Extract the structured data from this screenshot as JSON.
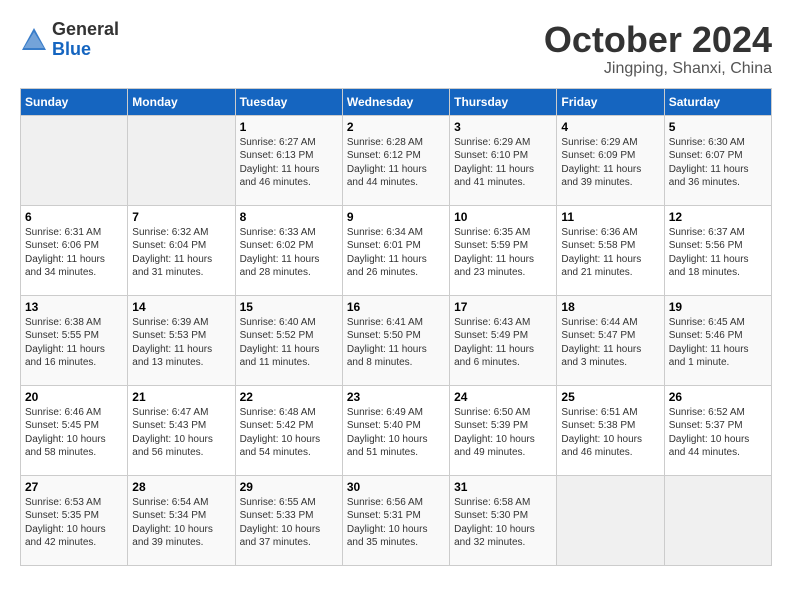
{
  "header": {
    "logo_general": "General",
    "logo_blue": "Blue",
    "month": "October 2024",
    "location": "Jingping, Shanxi, China"
  },
  "days_of_week": [
    "Sunday",
    "Monday",
    "Tuesday",
    "Wednesday",
    "Thursday",
    "Friday",
    "Saturday"
  ],
  "weeks": [
    [
      {
        "day": "",
        "content": ""
      },
      {
        "day": "",
        "content": ""
      },
      {
        "day": "1",
        "content": "Sunrise: 6:27 AM\nSunset: 6:13 PM\nDaylight: 11 hours and 46 minutes."
      },
      {
        "day": "2",
        "content": "Sunrise: 6:28 AM\nSunset: 6:12 PM\nDaylight: 11 hours and 44 minutes."
      },
      {
        "day": "3",
        "content": "Sunrise: 6:29 AM\nSunset: 6:10 PM\nDaylight: 11 hours and 41 minutes."
      },
      {
        "day": "4",
        "content": "Sunrise: 6:29 AM\nSunset: 6:09 PM\nDaylight: 11 hours and 39 minutes."
      },
      {
        "day": "5",
        "content": "Sunrise: 6:30 AM\nSunset: 6:07 PM\nDaylight: 11 hours and 36 minutes."
      }
    ],
    [
      {
        "day": "6",
        "content": "Sunrise: 6:31 AM\nSunset: 6:06 PM\nDaylight: 11 hours and 34 minutes."
      },
      {
        "day": "7",
        "content": "Sunrise: 6:32 AM\nSunset: 6:04 PM\nDaylight: 11 hours and 31 minutes."
      },
      {
        "day": "8",
        "content": "Sunrise: 6:33 AM\nSunset: 6:02 PM\nDaylight: 11 hours and 28 minutes."
      },
      {
        "day": "9",
        "content": "Sunrise: 6:34 AM\nSunset: 6:01 PM\nDaylight: 11 hours and 26 minutes."
      },
      {
        "day": "10",
        "content": "Sunrise: 6:35 AM\nSunset: 5:59 PM\nDaylight: 11 hours and 23 minutes."
      },
      {
        "day": "11",
        "content": "Sunrise: 6:36 AM\nSunset: 5:58 PM\nDaylight: 11 hours and 21 minutes."
      },
      {
        "day": "12",
        "content": "Sunrise: 6:37 AM\nSunset: 5:56 PM\nDaylight: 11 hours and 18 minutes."
      }
    ],
    [
      {
        "day": "13",
        "content": "Sunrise: 6:38 AM\nSunset: 5:55 PM\nDaylight: 11 hours and 16 minutes."
      },
      {
        "day": "14",
        "content": "Sunrise: 6:39 AM\nSunset: 5:53 PM\nDaylight: 11 hours and 13 minutes."
      },
      {
        "day": "15",
        "content": "Sunrise: 6:40 AM\nSunset: 5:52 PM\nDaylight: 11 hours and 11 minutes."
      },
      {
        "day": "16",
        "content": "Sunrise: 6:41 AM\nSunset: 5:50 PM\nDaylight: 11 hours and 8 minutes."
      },
      {
        "day": "17",
        "content": "Sunrise: 6:43 AM\nSunset: 5:49 PM\nDaylight: 11 hours and 6 minutes."
      },
      {
        "day": "18",
        "content": "Sunrise: 6:44 AM\nSunset: 5:47 PM\nDaylight: 11 hours and 3 minutes."
      },
      {
        "day": "19",
        "content": "Sunrise: 6:45 AM\nSunset: 5:46 PM\nDaylight: 11 hours and 1 minute."
      }
    ],
    [
      {
        "day": "20",
        "content": "Sunrise: 6:46 AM\nSunset: 5:45 PM\nDaylight: 10 hours and 58 minutes."
      },
      {
        "day": "21",
        "content": "Sunrise: 6:47 AM\nSunset: 5:43 PM\nDaylight: 10 hours and 56 minutes."
      },
      {
        "day": "22",
        "content": "Sunrise: 6:48 AM\nSunset: 5:42 PM\nDaylight: 10 hours and 54 minutes."
      },
      {
        "day": "23",
        "content": "Sunrise: 6:49 AM\nSunset: 5:40 PM\nDaylight: 10 hours and 51 minutes."
      },
      {
        "day": "24",
        "content": "Sunrise: 6:50 AM\nSunset: 5:39 PM\nDaylight: 10 hours and 49 minutes."
      },
      {
        "day": "25",
        "content": "Sunrise: 6:51 AM\nSunset: 5:38 PM\nDaylight: 10 hours and 46 minutes."
      },
      {
        "day": "26",
        "content": "Sunrise: 6:52 AM\nSunset: 5:37 PM\nDaylight: 10 hours and 44 minutes."
      }
    ],
    [
      {
        "day": "27",
        "content": "Sunrise: 6:53 AM\nSunset: 5:35 PM\nDaylight: 10 hours and 42 minutes."
      },
      {
        "day": "28",
        "content": "Sunrise: 6:54 AM\nSunset: 5:34 PM\nDaylight: 10 hours and 39 minutes."
      },
      {
        "day": "29",
        "content": "Sunrise: 6:55 AM\nSunset: 5:33 PM\nDaylight: 10 hours and 37 minutes."
      },
      {
        "day": "30",
        "content": "Sunrise: 6:56 AM\nSunset: 5:31 PM\nDaylight: 10 hours and 35 minutes."
      },
      {
        "day": "31",
        "content": "Sunrise: 6:58 AM\nSunset: 5:30 PM\nDaylight: 10 hours and 32 minutes."
      },
      {
        "day": "",
        "content": ""
      },
      {
        "day": "",
        "content": ""
      }
    ]
  ]
}
